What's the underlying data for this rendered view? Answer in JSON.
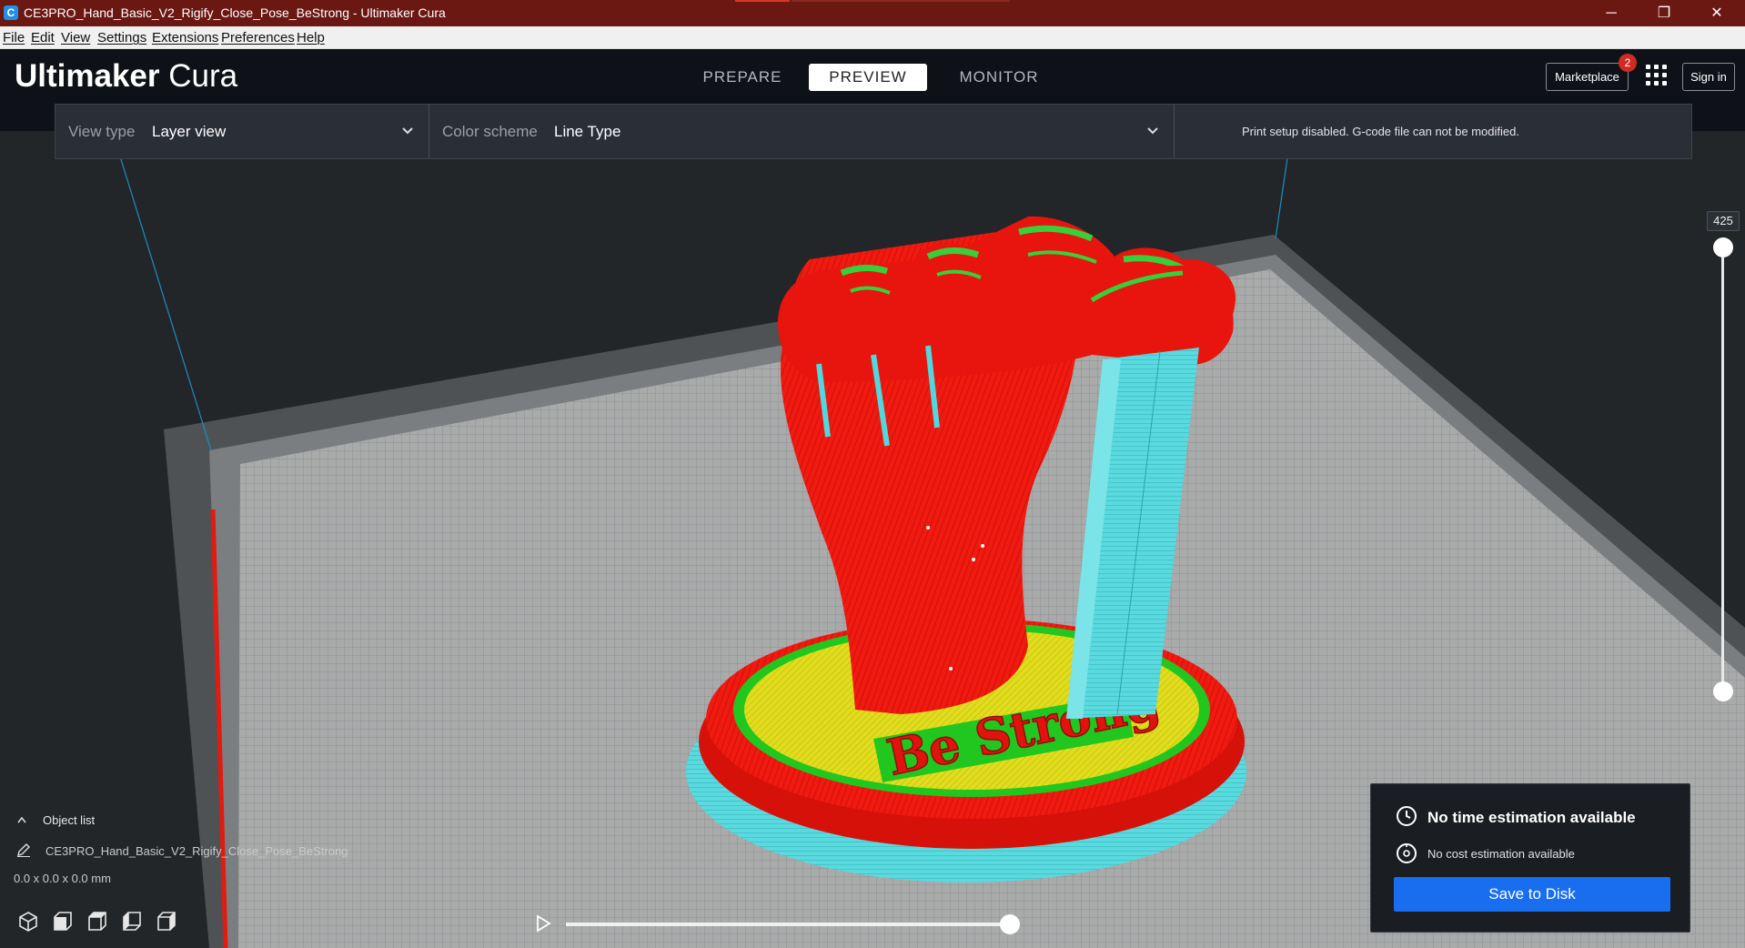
{
  "window": {
    "title": "CE3PRO_Hand_Basic_V2_Rigify_Close_Pose_BeStrong - Ultimaker Cura",
    "app_icon_letter": "C",
    "controls": {
      "minimize": "─",
      "restore": "❐",
      "close": "✕"
    }
  },
  "menu": [
    "File",
    "Edit",
    "View",
    "Settings",
    "Extensions",
    "Preferences",
    "Help"
  ],
  "header": {
    "logo_bold": "Ultimaker",
    "logo_light": "Cura",
    "tabs": [
      "PREPARE",
      "PREVIEW",
      "MONITOR"
    ],
    "active_tab": "PREVIEW",
    "marketplace_label": "Marketplace",
    "marketplace_badge": "2",
    "signin_label": "Sign in"
  },
  "viewbar": {
    "view_type_label": "View type",
    "view_type_value": "Layer view",
    "color_scheme_label": "Color scheme",
    "color_scheme_value": "Line Type",
    "notice": "Print setup disabled. G-code file can not be modified."
  },
  "text_on_model": "Be Strong",
  "layer_slider": {
    "value": "425"
  },
  "object_list": {
    "label": "Object list",
    "object_name": "CE3PRO_Hand_Basic_V2_Rigify_Close_Pose_BeStrong",
    "dimensions": "0.0 x 0.0 x 0.0 mm"
  },
  "camera_views": [
    "3d-view-icon",
    "front-view-icon",
    "top-view-icon",
    "left-view-icon",
    "right-view-icon"
  ],
  "estimate": {
    "time_text": "No time estimation available",
    "cost_text": "No cost estimation available",
    "save_label": "Save to Disk"
  },
  "colors": {
    "titlebar": "#6b1712",
    "header": "#0e1218",
    "wall_outer": "#ff1010",
    "wall_inner": "#22cc22",
    "skin": "#d8d81a",
    "support": "#52d7dc",
    "accent_button": "#196ef0"
  }
}
